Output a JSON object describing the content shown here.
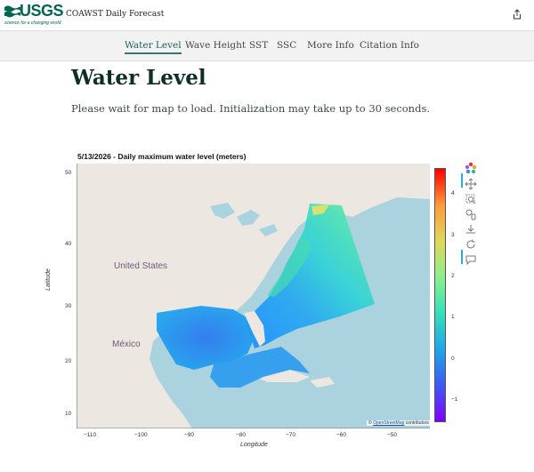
{
  "header": {
    "logo_text": "USGS",
    "logo_tagline": "science for a changing world",
    "app_title": "COAWST Daily Forecast",
    "share_icon": "share-icon"
  },
  "nav": {
    "tabs": [
      {
        "label": "Water Level",
        "active": true
      },
      {
        "label": "Wave Height",
        "active": false
      },
      {
        "label": "SST",
        "active": false
      },
      {
        "label": "SSC",
        "active": false
      },
      {
        "label": "More Info",
        "active": false
      },
      {
        "label": "Citation Info",
        "active": false
      }
    ]
  },
  "main": {
    "title": "Water Level",
    "subtitle": "Please wait for map to load. Initialization may take up to 30 seconds."
  },
  "plot": {
    "title": "5/13/2026 - Daily maximum water level (meters)",
    "xlabel": "Longitude",
    "ylabel": "Latitude",
    "xticks": [
      "−110",
      "−100",
      "−90",
      "−80",
      "−70",
      "−60",
      "−50"
    ],
    "yticks": [
      "50",
      "40",
      "30",
      "20",
      "10"
    ],
    "map_labels": {
      "country_us": "United States",
      "country_mx": "México"
    },
    "attribution_prefix": "©",
    "attribution_link": "OpenStreetMap",
    "attribution_suffix": "contributors",
    "colorbar_ticks": [
      "4",
      "3",
      "2",
      "1",
      "0",
      "−1"
    ],
    "toolbar": [
      "bokeh-logo-icon",
      "pan-icon",
      "box-zoom-icon",
      "wheel-zoom-icon",
      "save-icon",
      "reset-icon",
      "hover-icon"
    ]
  },
  "chart_data": {
    "type": "heatmap",
    "title": "5/13/2026 - Daily maximum water level (meters)",
    "xlabel": "Longitude",
    "ylabel": "Latitude",
    "xlim": [
      -113,
      -43
    ],
    "ylim": [
      8,
      52
    ],
    "colorbar_range": [
      -1.5,
      4.5
    ],
    "colorbar_ticks": [
      -1,
      0,
      1,
      2,
      3,
      4
    ],
    "colormap": [
      "#7f00ff",
      "#3c5bf0",
      "#1fa6e8",
      "#33e0b8",
      "#8cf08a",
      "#e0d85a",
      "#ff9a3a",
      "#ff0000"
    ],
    "colors": {
      "ocean_low": "#1e90ff",
      "ocean_mid": "#33d9c8",
      "ocean_high": "#7ff0a0",
      "land": "#ece8e1",
      "sea": "#aad3df"
    }
  }
}
